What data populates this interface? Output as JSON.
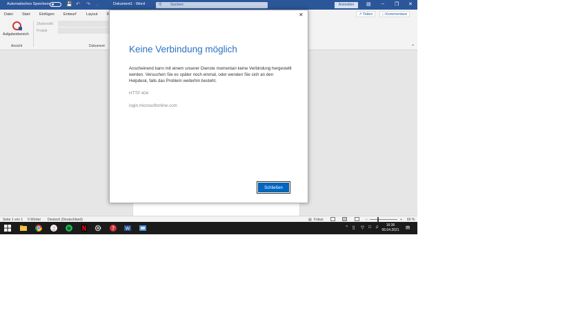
{
  "titlebar": {
    "autosave_label": "Automatisches Speichern",
    "doc_title": "Dokument1 - Word",
    "search_placeholder": "Suchen",
    "signin_label": "Anmelden"
  },
  "tabs": [
    "Datei",
    "Start",
    "Einfügen",
    "Entwurf",
    "Layout",
    "R"
  ],
  "share_label": "Teilen",
  "comments_label": "Kommentare",
  "ribbon": {
    "taskpane_label": "Aufgabenbereich",
    "group_view": "Ansicht",
    "group_document": "Dokument",
    "field1_label": "Zitationstitl",
    "field2_label": "Projekt"
  },
  "dialog": {
    "title": "Keine Verbindung möglich",
    "message": "Anscheinend kann mit einem unserer Dienste momentan keine Verbindung hergestellt werden. Versuchen Sie es später noch einmal, oder wenden Sie sich an den Helpdesk, falls das Problem weiterhin besteht.",
    "code": "HTTP 404",
    "host": "login.microsoftonline.com",
    "close_button": "Schließen"
  },
  "statusbar": {
    "page": "Seite 1 von 1",
    "words": "0 Wörter",
    "language": "Deutsch (Deutschland)",
    "focus": "Fokus",
    "zoom": "60 %"
  },
  "taskbar": {
    "time": "16:36",
    "date": "06.04.2021"
  },
  "colors": {
    "word_blue": "#2b579a",
    "dialog_title": "#2b72c2",
    "primary_button": "#0067c0"
  }
}
